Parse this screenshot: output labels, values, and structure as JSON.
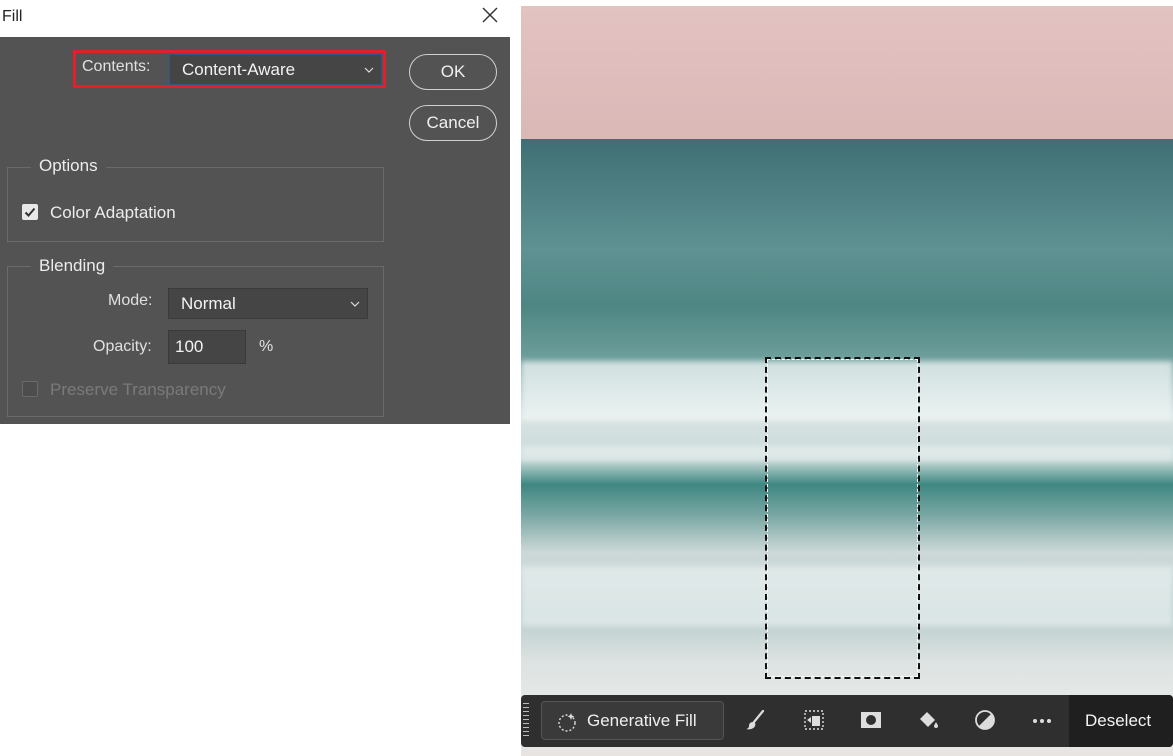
{
  "dialog": {
    "title": "Fill",
    "contents_label": "Contents:",
    "contents_value": "Content-Aware",
    "ok_label": "OK",
    "cancel_label": "Cancel",
    "options": {
      "title": "Options",
      "color_adaptation_label": "Color Adaptation",
      "color_adaptation_checked": true
    },
    "blending": {
      "title": "Blending",
      "mode_label": "Mode:",
      "mode_value": "Normal",
      "opacity_label": "Opacity:",
      "opacity_value": "100",
      "opacity_unit": "%",
      "preserve_transparency_label": "Preserve Transparency",
      "preserve_transparency_checked": false,
      "preserve_transparency_disabled": true
    },
    "highlight_color": "#e0202a"
  },
  "taskbar": {
    "generative_fill_label": "Generative Fill",
    "icons": [
      "generative-fill-icon",
      "brush-icon",
      "transform-selection-icon",
      "mask-icon",
      "paint-bucket-icon",
      "adjustment-icon",
      "more-icon"
    ],
    "deselect_label": "Deselect"
  }
}
